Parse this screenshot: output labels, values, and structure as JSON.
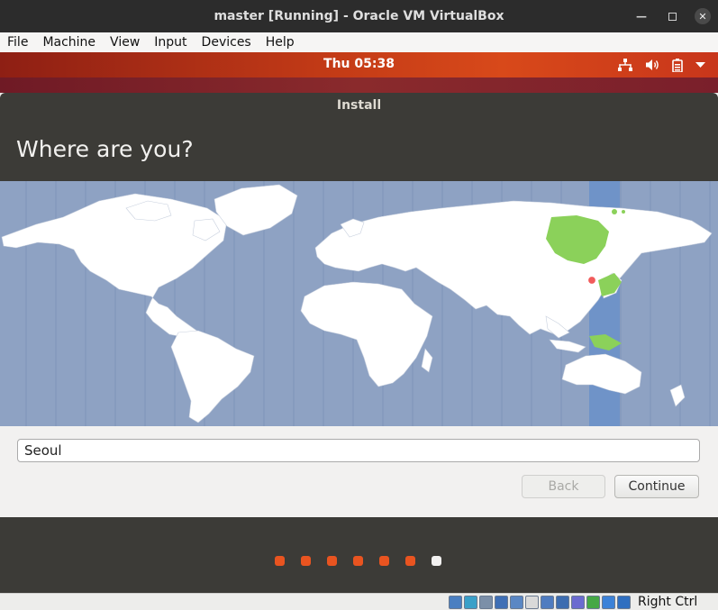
{
  "host": {
    "window_title": "master [Running] - Oracle VM VirtualBox",
    "menu": [
      "File",
      "Machine",
      "View",
      "Input",
      "Devices",
      "Help"
    ],
    "host_key": "Right Ctrl",
    "status_icons": [
      "hard-disk-icon",
      "optical-disk-icon",
      "audio-icon",
      "network-icon",
      "usb-icon",
      "shared-folders-icon",
      "display-icon",
      "video-capture-icon",
      "recording-icon",
      "cpu-icon",
      "mouse-integration-icon",
      "host-key-arrow-icon"
    ]
  },
  "guest": {
    "clock": "Thu 05:38",
    "tray_icons": [
      "network-icon",
      "volume-icon",
      "battery-icon",
      "dropdown-arrow-icon"
    ]
  },
  "installer": {
    "window_title": "Install",
    "heading": "Where are you?",
    "timezone_value": "Seoul",
    "back_label": "Back",
    "continue_label": "Continue",
    "progress": {
      "total": 7,
      "current": 7
    },
    "colors": {
      "map_ocean": "#8ea2c3",
      "map_land": "#ffffff",
      "selected_zone": "#6f93c8",
      "selected_land": "#8bd15a",
      "step_done": "#e95420",
      "step_current": "#f2f1f0"
    }
  }
}
